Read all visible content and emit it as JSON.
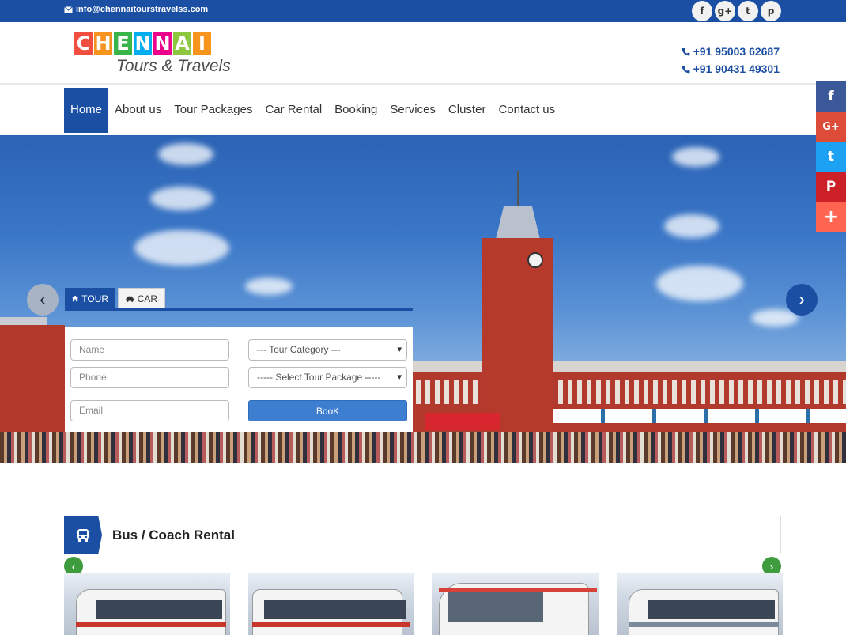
{
  "topbar": {
    "email": "info@chennaitourstravelss.com",
    "social": [
      "f",
      "g+",
      "t",
      "p"
    ]
  },
  "logo": {
    "letters": [
      "C",
      "H",
      "E",
      "N",
      "N",
      "A",
      "I"
    ],
    "letter_colors": [
      "#f04e3e",
      "#f7941d",
      "#39b54a",
      "#00aeef",
      "#ec008c",
      "#8dc63f",
      "#f7941d"
    ],
    "subtitle": "Tours & Travels"
  },
  "contact": {
    "phone1": "+91 95003 62687",
    "phone2": "+91 90431 49301"
  },
  "nav": {
    "items": [
      "Home",
      "About us",
      "Tour Packages",
      "Car Rental",
      "Booking",
      "Services",
      "Cluster",
      "Contact us"
    ],
    "active": "Home"
  },
  "share_bar": [
    {
      "icon": "facebook-icon",
      "glyph": "f",
      "color": "#3b5998"
    },
    {
      "icon": "google-plus-icon",
      "glyph": "G+",
      "color": "#dd4b39"
    },
    {
      "icon": "twitter-icon",
      "glyph": "t",
      "color": "#1da1f2"
    },
    {
      "icon": "pinterest-icon",
      "glyph": "P",
      "color": "#cb2027"
    },
    {
      "icon": "plus-icon",
      "glyph": "+",
      "color": "#ff6550"
    }
  ],
  "booking": {
    "tab_tour": "TOUR",
    "tab_car": "CAR",
    "name_placeholder": "Name",
    "phone_placeholder": "Phone",
    "email_placeholder": "Email",
    "category_value": "--- Tour Category ---",
    "package_value": "----- Select Tour Package -----",
    "book_label": "BooK"
  },
  "bus_section": {
    "title": "Bus / Coach Rental",
    "prev": "‹",
    "next": "›"
  },
  "colors": {
    "brand_blue": "#1b4fa3",
    "green": "#3e9b3e"
  }
}
